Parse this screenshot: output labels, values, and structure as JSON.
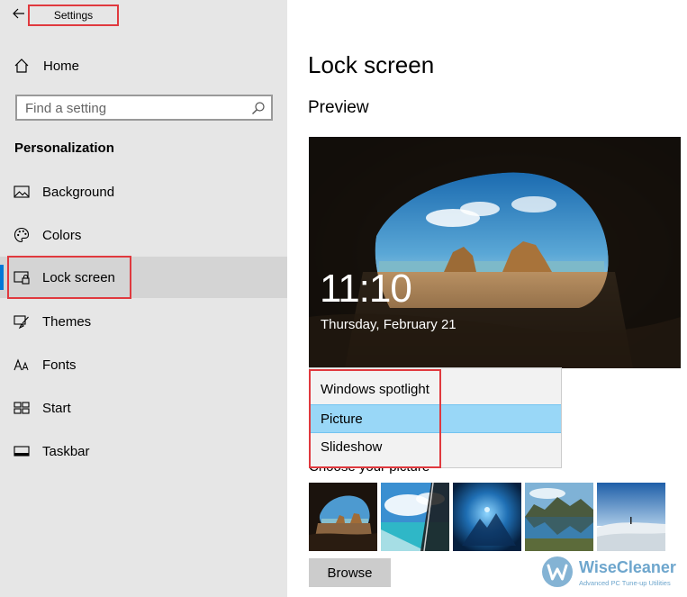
{
  "window": {
    "title": "Settings"
  },
  "sidebar": {
    "home_label": "Home",
    "search_placeholder": "Find a setting",
    "section_title": "Personalization",
    "items": [
      {
        "label": "Background",
        "icon": "picture-icon"
      },
      {
        "label": "Colors",
        "icon": "palette-icon"
      },
      {
        "label": "Lock screen",
        "icon": "lock-screen-icon",
        "active": true
      },
      {
        "label": "Themes",
        "icon": "brush-icon"
      },
      {
        "label": "Fonts",
        "icon": "fonts-icon"
      },
      {
        "label": "Start",
        "icon": "start-tiles-icon"
      },
      {
        "label": "Taskbar",
        "icon": "taskbar-icon"
      }
    ]
  },
  "main": {
    "title": "Lock screen",
    "preview_heading": "Preview",
    "preview_time": "11:10",
    "preview_date": "Thursday, February 21",
    "background_options": [
      "Windows spotlight",
      "Picture",
      "Slideshow"
    ],
    "selected_option": "Picture",
    "choose_picture_label": "Choose your picture",
    "browse_label": "Browse"
  },
  "watermark": {
    "name": "WiseCleaner",
    "tagline": "Advanced PC Tune-up Utilities"
  },
  "colors": {
    "accent": "#0078d7",
    "highlight_box": "#e0393e",
    "selected_option_bg": "#99d7f7",
    "sidebar_bg": "#e6e6e6"
  }
}
